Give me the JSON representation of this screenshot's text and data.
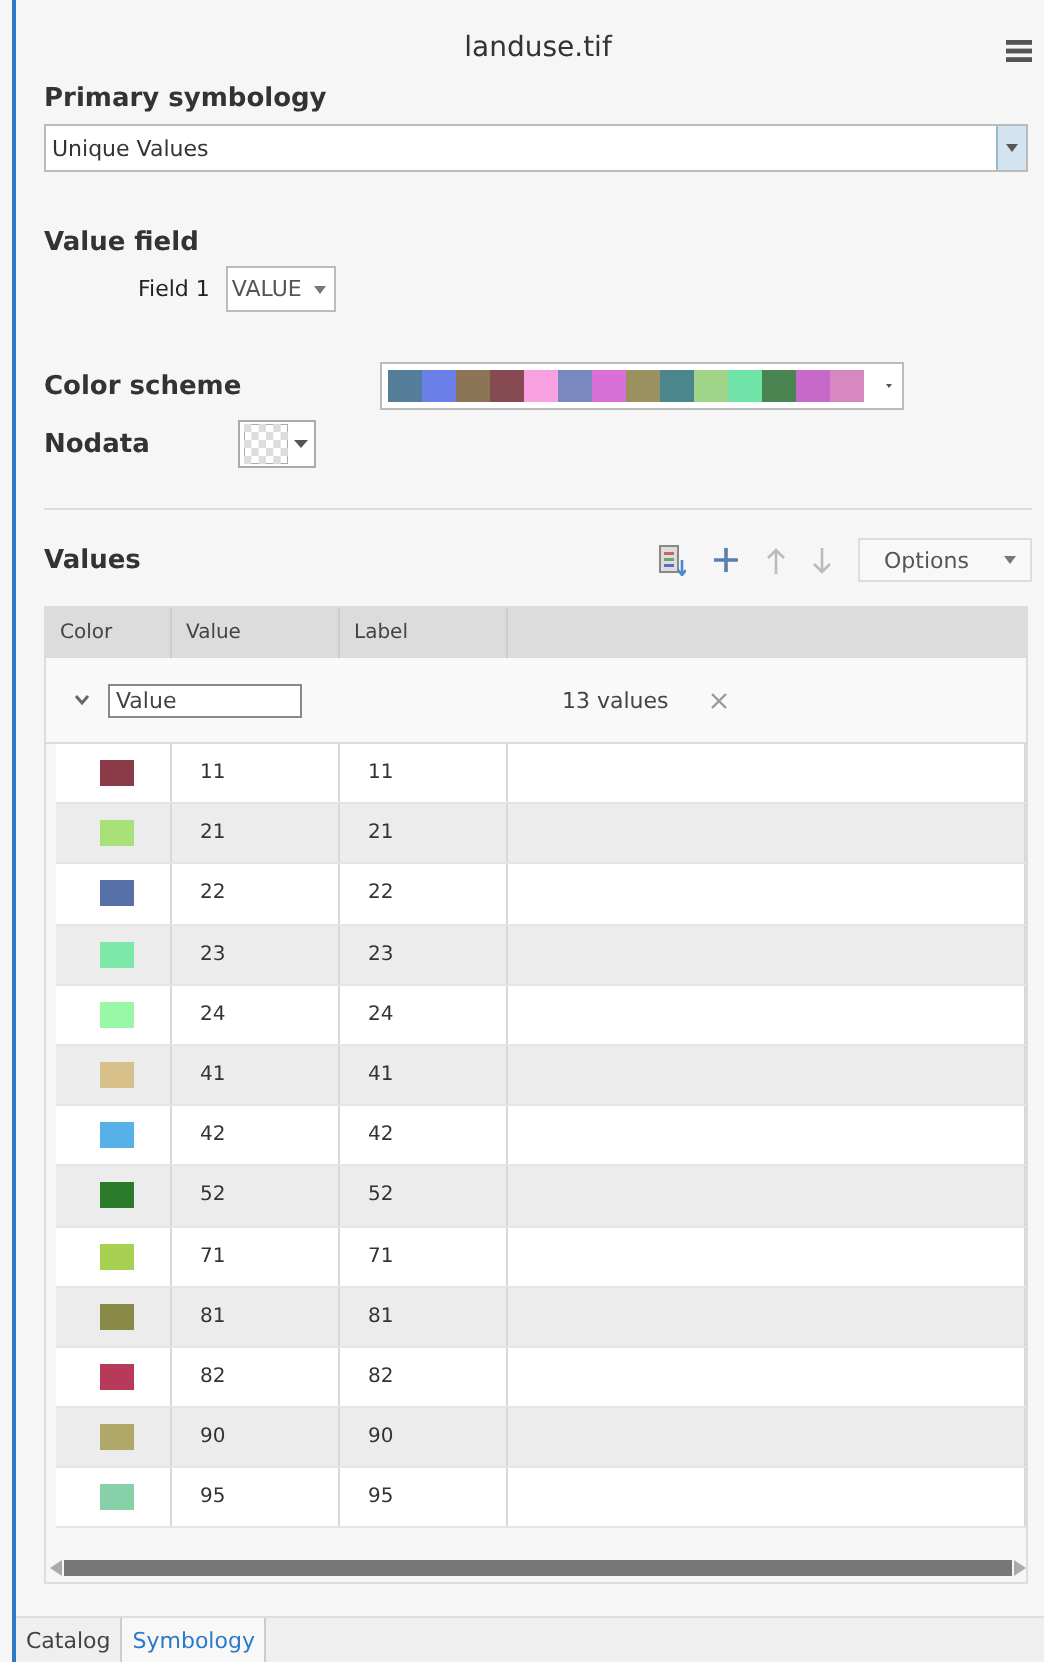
{
  "panel": {
    "title": "landuse.tif"
  },
  "primary_symbology": {
    "label": "Primary symbology",
    "value": "Unique Values"
  },
  "value_field": {
    "label": "Value field",
    "field_label": "Field 1",
    "field_value": "VALUE"
  },
  "color_scheme": {
    "label": "Color scheme",
    "swatches": [
      {
        "color": "#547d99"
      },
      {
        "color": "#6a80e8"
      },
      {
        "color": "#8c7556"
      },
      {
        "color": "#864a52"
      },
      {
        "color": "#f8a0e0"
      },
      {
        "color": "#7a88c0"
      },
      {
        "color": "#d870d8"
      },
      {
        "color": "#9a9060"
      },
      {
        "color": "#4a868c"
      },
      {
        "color": "#a0d488"
      },
      {
        "color": "#70e4a8"
      },
      {
        "color": "#4a8450"
      },
      {
        "color": "#c868c8"
      },
      {
        "color": "#d888c0"
      }
    ]
  },
  "nodata": {
    "label": "Nodata"
  },
  "values": {
    "label": "Values",
    "options_button": "Options",
    "columns": [
      "Color",
      "Value",
      "Label"
    ],
    "group": {
      "expanded": true,
      "field": "Value",
      "count": "13 values"
    },
    "rows": [
      {
        "color": "#8b3a47",
        "value": "11",
        "label": "11"
      },
      {
        "color": "#a8e07a",
        "value": "21",
        "label": "21"
      },
      {
        "color": "#5870a8",
        "value": "22",
        "label": "22"
      },
      {
        "color": "#7de8a8",
        "value": "23",
        "label": "23"
      },
      {
        "color": "#98f8a8",
        "value": "24",
        "label": "24"
      },
      {
        "color": "#d8c08a",
        "value": "41",
        "label": "41"
      },
      {
        "color": "#58b0e8",
        "value": "42",
        "label": "42"
      },
      {
        "color": "#2a7a2a",
        "value": "52",
        "label": "52"
      },
      {
        "color": "#a8d050",
        "value": "71",
        "label": "71"
      },
      {
        "color": "#8a8a48",
        "value": "81",
        "label": "81"
      },
      {
        "color": "#b83a5a",
        "value": "82",
        "label": "82"
      },
      {
        "color": "#b0a868",
        "value": "90",
        "label": "90"
      },
      {
        "color": "#88d0a8",
        "value": "95",
        "label": "95"
      }
    ]
  },
  "tabs": [
    {
      "label": "Catalog",
      "selected": false
    },
    {
      "label": "Symbology",
      "selected": true
    }
  ]
}
